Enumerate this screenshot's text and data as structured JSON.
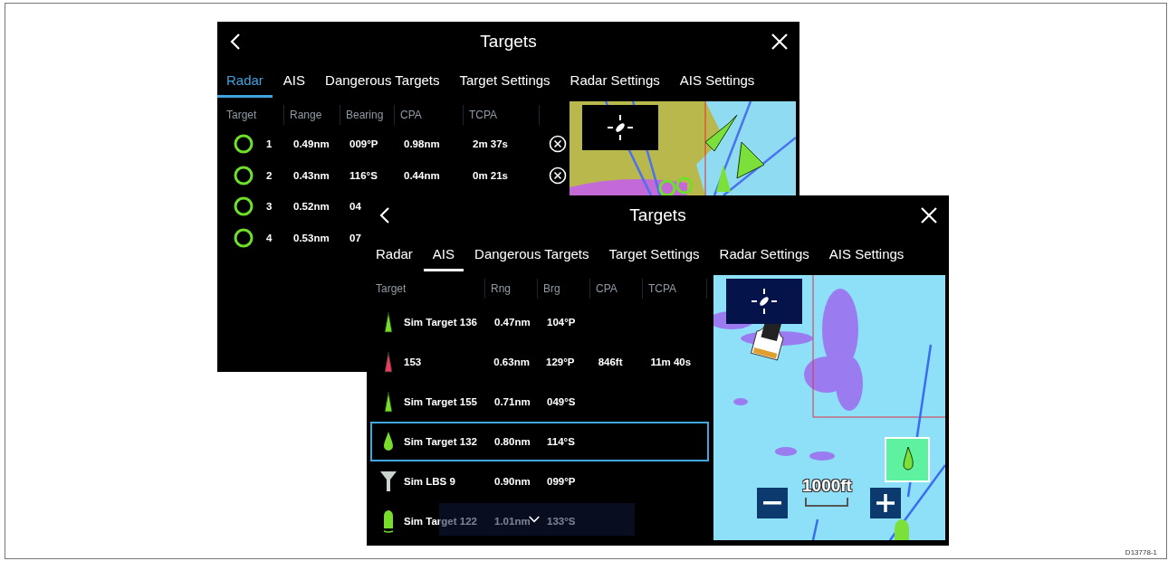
{
  "windows": [
    {
      "title": "Targets",
      "tabs": [
        {
          "label": "Radar",
          "selected": true
        },
        {
          "label": "AIS",
          "selected": false
        },
        {
          "label": "Dangerous Targets",
          "selected": false
        },
        {
          "label": "Target Settings",
          "selected": false
        },
        {
          "label": "Radar Settings",
          "selected": false
        },
        {
          "label": "AIS Settings",
          "selected": false
        }
      ],
      "columns": [
        "Target",
        "Range",
        "Bearing",
        "CPA",
        "TCPA"
      ],
      "rows": [
        {
          "kind": "radar",
          "cells": [
            "1",
            "0.49nm",
            "009°P",
            "0.98nm",
            "2m 37s"
          ],
          "removable": true,
          "selected": false
        },
        {
          "kind": "radar",
          "cells": [
            "2",
            "0.43nm",
            "116°S",
            "0.44nm",
            "0m 21s"
          ],
          "removable": true,
          "selected": false
        },
        {
          "kind": "radar",
          "cells": [
            "3",
            "0.52nm",
            "04"
          ],
          "removable": false,
          "selected": false
        },
        {
          "kind": "radar",
          "cells": [
            "4",
            "0.53nm",
            "07"
          ],
          "removable": false,
          "selected": false
        }
      ]
    },
    {
      "title": "Targets",
      "tabs": [
        {
          "label": "Radar",
          "selected": false
        },
        {
          "label": "AIS",
          "selected": true
        },
        {
          "label": "Dangerous Targets",
          "selected": false
        },
        {
          "label": "Target Settings",
          "selected": false
        },
        {
          "label": "Radar Settings",
          "selected": false
        },
        {
          "label": "AIS Settings",
          "selected": false
        }
      ],
      "columns": [
        "Target",
        "Rng",
        "Brg",
        "CPA",
        "TCPA"
      ],
      "rows": [
        {
          "kind": "triangle",
          "color": "#79dc2c",
          "cells": [
            "Sim Target 136",
            "0.47nm",
            "104°P"
          ],
          "selected": false
        },
        {
          "kind": "triangle",
          "color": "#ee3b62",
          "cells": [
            "153",
            "0.63nm",
            "129°P",
            "846ft",
            "11m 40s"
          ],
          "selected": false
        },
        {
          "kind": "triangle",
          "color": "#79dc2c",
          "cells": [
            "Sim Target 155",
            "0.71nm",
            "049°S"
          ],
          "selected": false
        },
        {
          "kind": "drop",
          "color": "#79dc2c",
          "cells": [
            "Sim Target 132",
            "0.80nm",
            "114°S"
          ],
          "selected": true
        },
        {
          "kind": "funnel",
          "color": "#c8d4cc",
          "cells": [
            "Sim LBS 9",
            "0.90nm",
            "099°P"
          ],
          "selected": false
        },
        {
          "kind": "capsule",
          "color": "#79dc2c",
          "cells": [
            "Sim Target 122",
            "1.01nm",
            "133°S"
          ],
          "selected": false
        }
      ],
      "scroll_down": true,
      "map_scale": "1000ft"
    }
  ],
  "figure_id": "D13778-1"
}
